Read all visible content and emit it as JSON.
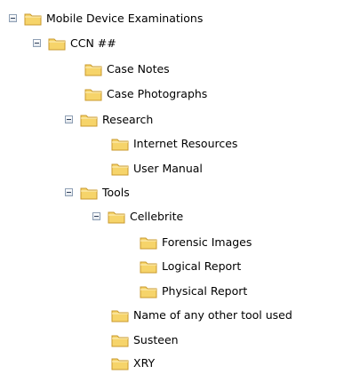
{
  "tree": {
    "items": [
      {
        "label": "Mobile Device Examinations",
        "expanded": true,
        "icon": "folder-icon"
      },
      {
        "label": "CCN ##",
        "expanded": true,
        "icon": "folder-icon"
      },
      {
        "label": "Case Notes",
        "icon": "folder-icon"
      },
      {
        "label": "Case Photographs",
        "icon": "folder-icon"
      },
      {
        "label": "Research",
        "expanded": true,
        "icon": "folder-icon"
      },
      {
        "label": "Internet Resources",
        "icon": "folder-icon"
      },
      {
        "label": "User Manual",
        "icon": "folder-icon"
      },
      {
        "label": "Tools",
        "expanded": true,
        "icon": "folder-icon"
      },
      {
        "label": "Cellebrite",
        "expanded": true,
        "icon": "folder-icon"
      },
      {
        "label": "Forensic Images",
        "icon": "folder-icon"
      },
      {
        "label": "Logical Report",
        "icon": "folder-icon"
      },
      {
        "label": "Physical Report",
        "icon": "folder-icon"
      },
      {
        "label": "Name of any other tool used",
        "icon": "folder-icon"
      },
      {
        "label": "Susteen",
        "icon": "folder-icon"
      },
      {
        "label": "XRY",
        "icon": "folder-icon"
      }
    ]
  },
  "colors": {
    "folder_fill": "#f6d46a",
    "folder_tab": "#f2c24c",
    "folder_edge": "#c99a2d",
    "toggle_border": "#8e9fb4"
  }
}
